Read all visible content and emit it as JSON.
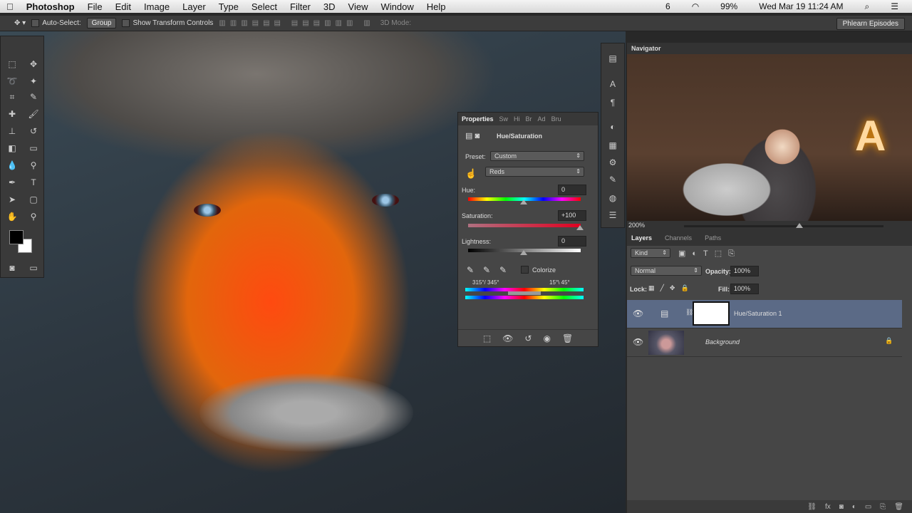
{
  "menubar": {
    "app": "Photoshop",
    "items": [
      "File",
      "Edit",
      "Image",
      "Layer",
      "Type",
      "Select",
      "Filter",
      "3D",
      "View",
      "Window",
      "Help"
    ],
    "battery": "99%",
    "datetime": "Wed Mar 19  11:24 AM",
    "badge": "6"
  },
  "options": {
    "auto_select": "Auto-Select:",
    "group": "Group",
    "transform": "Show Transform Controls",
    "mode3d": "3D Mode:",
    "workspace": "Phlearn Episodes"
  },
  "properties": {
    "tabs": [
      "Properties",
      "Sw",
      "Hi",
      "Br",
      "Ad",
      "Bru"
    ],
    "title": "Hue/Saturation",
    "preset_label": "Preset:",
    "preset": "Custom",
    "channel": "Reds",
    "hue_label": "Hue:",
    "hue": "0",
    "sat_label": "Saturation:",
    "sat": "+100",
    "light_label": "Lightness:",
    "light": "0",
    "colorize": "Colorize",
    "range_left": "315°/ 345°",
    "range_right": "15°\\ 45°",
    "hue_value": 0,
    "sat_value": 100,
    "light_value": 0
  },
  "navigator": {
    "title": "Navigator",
    "zoom": "200%"
  },
  "layers": {
    "tabs": [
      "Layers",
      "Channels",
      "Paths"
    ],
    "kind": "Kind",
    "blend": "Normal",
    "opacity_label": "Opacity:",
    "opacity": "100%",
    "lock_label": "Lock:",
    "fill_label": "Fill:",
    "fill": "100%",
    "items": [
      {
        "name": "Hue/Saturation 1"
      },
      {
        "name": "Background"
      }
    ]
  }
}
